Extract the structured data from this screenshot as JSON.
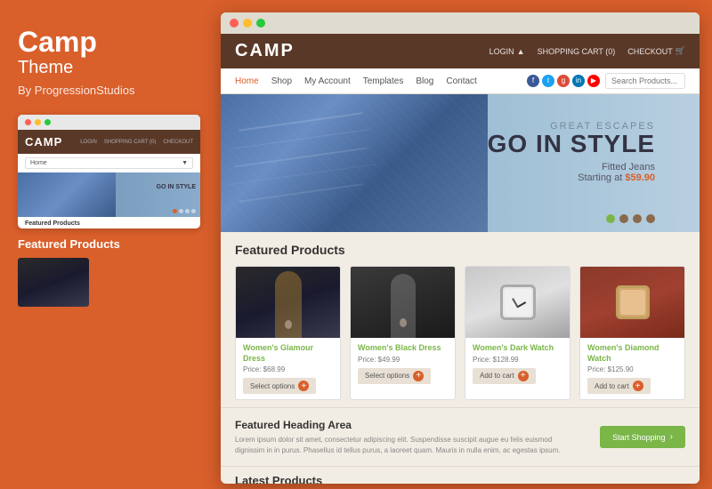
{
  "left": {
    "title": "Camp",
    "subtitle": "Theme",
    "author": "By ProgressionStudios",
    "mini_logo": "CAMP",
    "mini_actions": {
      "login": "LOGIN",
      "cart": "SHOPPING CART (0)",
      "checkout": "CHECKOUT"
    },
    "mini_nav": {
      "home": "Home",
      "dropdown_arrow": "▼"
    },
    "featured_label": "Featured Products"
  },
  "main": {
    "logo": "CAMP",
    "header": {
      "login": "LOGIN",
      "cart": "SHOPPING CART (0)",
      "checkout": "CHECKOUT"
    },
    "nav": {
      "items": [
        "Home",
        "Shop",
        "My Account",
        "Templates",
        "Blog",
        "Contact"
      ],
      "active": "Home"
    },
    "search_placeholder": "Search Products...",
    "hero": {
      "eyebrow": "GREAT ESCAPES",
      "headline": "GO IN STYLE",
      "subline": "Fitted Jeans",
      "price_label": "Starting at",
      "price": "$59.90"
    },
    "featured": {
      "title": "Featured Products",
      "products": [
        {
          "name": "Women's Glamour Dress",
          "price": "Price: $68.99",
          "button": "Select options",
          "type": "dress1"
        },
        {
          "name": "Women's Black Dress",
          "price": "Price: $49.99",
          "button": "Select options",
          "type": "dress2"
        },
        {
          "name": "Women's Dark Watch",
          "price": "Price: $128.99",
          "button": "Add to cart",
          "type": "watch1"
        },
        {
          "name": "Women's Diamond Watch",
          "price": "Price: $125.90",
          "button": "Add to cart",
          "type": "watch2"
        }
      ]
    },
    "featured_area": {
      "title": "Featured Heading Area",
      "description": "Lorem ipsum dolor sit amet, consectetur adipiscing elit. Suspendisse suscipit augue eu felis euismod dignissim in in purus. Phasellus id tellus purus, a laoreet quam. Mauris in nulla enim, ac egestas ipsum.",
      "button": "Start Shopping"
    },
    "latest": {
      "title": "Latest Products"
    }
  }
}
